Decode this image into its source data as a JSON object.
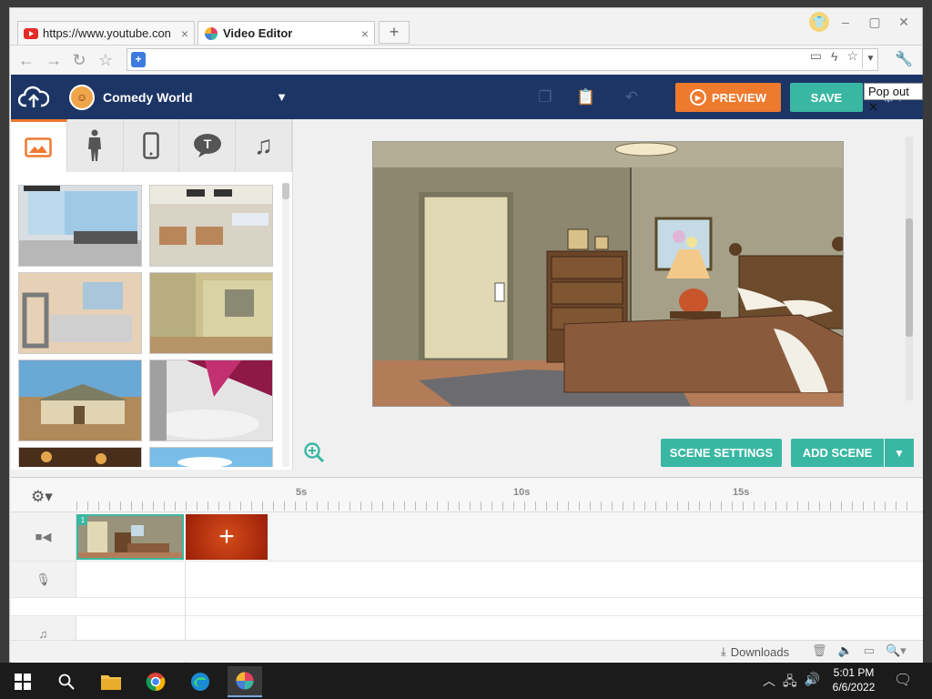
{
  "browser": {
    "tabs": [
      {
        "title": "https://www.youtube.con",
        "icon": "youtube-icon"
      },
      {
        "title": "Video Editor",
        "icon": "pinwheel-icon"
      }
    ],
    "new_tab_label": "+",
    "close_glyph": "×"
  },
  "app": {
    "project_name": "Comedy World",
    "buttons": {
      "preview": "PREVIEW",
      "save": "SAVE",
      "scene_settings": "SCENE SETTINGS",
      "add_scene": "ADD SCENE"
    },
    "popout_tooltip": "Pop out",
    "library_tabs": [
      "backgrounds",
      "characters",
      "props",
      "text",
      "music"
    ],
    "thumbnails": [
      "airport-lounge",
      "airport-checkin",
      "security-checkpoint",
      "office-corridor",
      "farmhouse",
      "stage-spotlights",
      "theater",
      "sky"
    ]
  },
  "timeline": {
    "ticks": [
      "5s",
      "10s",
      "15s"
    ],
    "clip_number": "1"
  },
  "statusbar": {
    "downloads": "Downloads"
  },
  "taskbar": {
    "time": "5:01 PM",
    "date": "6/6/2022"
  },
  "colors": {
    "accent": "#3ab7a3",
    "preview": "#ee7a2e",
    "topbar": "#1c3565"
  }
}
